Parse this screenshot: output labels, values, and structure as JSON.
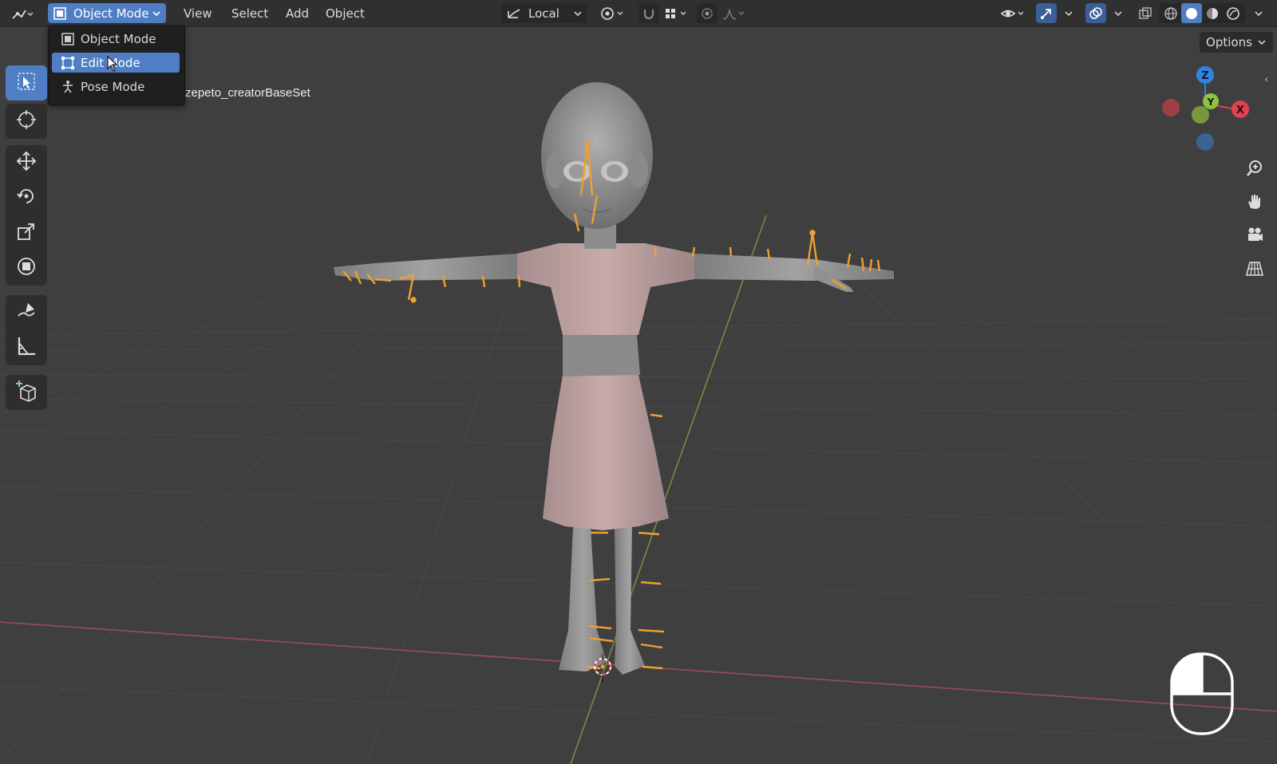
{
  "header": {
    "editor_type_icon": "viewport-editor-icon",
    "mode": "Object Mode",
    "menus": [
      "View",
      "Select",
      "Add",
      "Object"
    ],
    "transform_orientation": "Local",
    "options": "Options"
  },
  "mode_menu": {
    "items": [
      {
        "label": "Object Mode",
        "icon": "object-mode-icon",
        "active": false
      },
      {
        "label": "Edit Mode",
        "icon": "edit-mode-icon",
        "active": true
      },
      {
        "label": "Pose Mode",
        "icon": "pose-mode-icon",
        "active": false
      }
    ]
  },
  "viewport": {
    "object_name": "zepeto_creatorBaseSet"
  },
  "gizmo": {
    "axes": [
      "Z",
      "Y",
      "X"
    ],
    "colors": {
      "x": "#e0414f",
      "y": "#8bc53f",
      "z": "#2f83e4",
      "neg_x": "#b54149",
      "neg_z": "#3a6aa3"
    }
  },
  "toolbar": {
    "tools": [
      "select-box-icon",
      "cursor-icon",
      "move-icon",
      "rotate-icon",
      "scale-icon",
      "transform-icon",
      "annotate-icon",
      "measure-icon",
      "add-cube-icon"
    ]
  },
  "colors": {
    "accent": "#4f7ec4",
    "bone": "#f0a030",
    "x_axis": "#c25060",
    "y_axis": "#7ea04a"
  }
}
